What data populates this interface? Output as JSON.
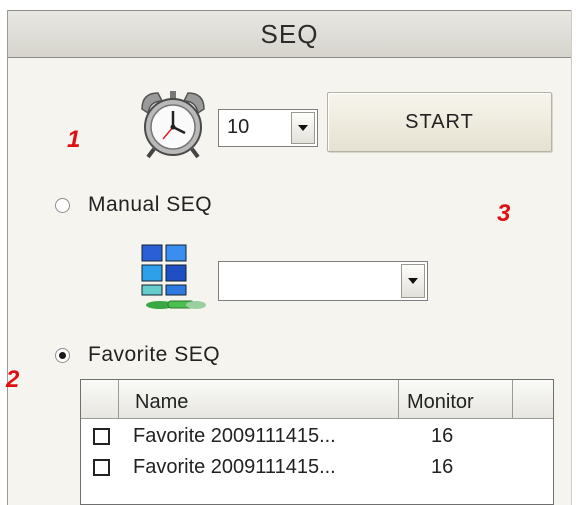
{
  "header": {
    "title": "SEQ"
  },
  "callouts": [
    "1",
    "2",
    "3"
  ],
  "interval": {
    "value": "10"
  },
  "start_button": {
    "label": "START"
  },
  "manual": {
    "label": "Manual SEQ",
    "selected": false,
    "group_value": ""
  },
  "favorite": {
    "label": "Favorite SEQ",
    "selected": true
  },
  "table": {
    "columns": [
      "Name",
      "Monitor"
    ],
    "rows": [
      {
        "name": "Favorite 2009111415...",
        "monitor": "16",
        "checked": false
      },
      {
        "name": "Favorite 2009111415...",
        "monitor": "16",
        "checked": false
      }
    ]
  },
  "icons": [
    "alarm-clock-icon",
    "network-group-icon",
    "dropdown-arrow-icon"
  ]
}
